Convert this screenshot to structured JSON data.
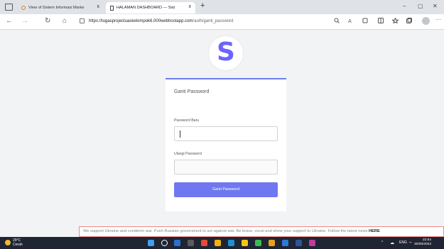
{
  "browser": {
    "tabs": [
      {
        "title": "View of Sistem Informasi Marke",
        "close": "x"
      },
      {
        "title": "HALAMAN DASHBOARD — Sist",
        "close": "x"
      }
    ],
    "new_tab": "+",
    "window_controls": {
      "minimize": "–",
      "maximize": "▢",
      "close": "✕"
    },
    "nav": {
      "back": "←",
      "forward": "→",
      "reload": "↻",
      "home": "⌂"
    },
    "url_host": "https://tugasprojectuaskelompok6.000webhostapp.com",
    "url_path": "/auth/ganti_password",
    "toolbar_icons": [
      "search-icon",
      "read-aloud-icon",
      "extensions-icon",
      "split-screen-icon",
      "favorites-icon",
      "collections-icon",
      "profile-icon",
      "more-icon"
    ],
    "more": "···"
  },
  "page": {
    "logo_letter": "S",
    "card_title": "Ganti Password",
    "new_password_label": "Password Baru",
    "new_password_value": "",
    "confirm_label": "Ulangi Password",
    "confirm_value": "",
    "submit_label": "Ganti Password",
    "accent_color": "#6f78f0"
  },
  "banner": {
    "text": "We support Ukraine and condemn war. Push Russian government to act against war. Be brave, vocal and show your support to Ukraine. Follow the latest news ",
    "link": "HERE"
  },
  "taskbar": {
    "weather_temp": "29°C",
    "weather_desc": "Cerah",
    "lang": "ENG",
    "time": "22:54",
    "date": "30/05/2022"
  }
}
